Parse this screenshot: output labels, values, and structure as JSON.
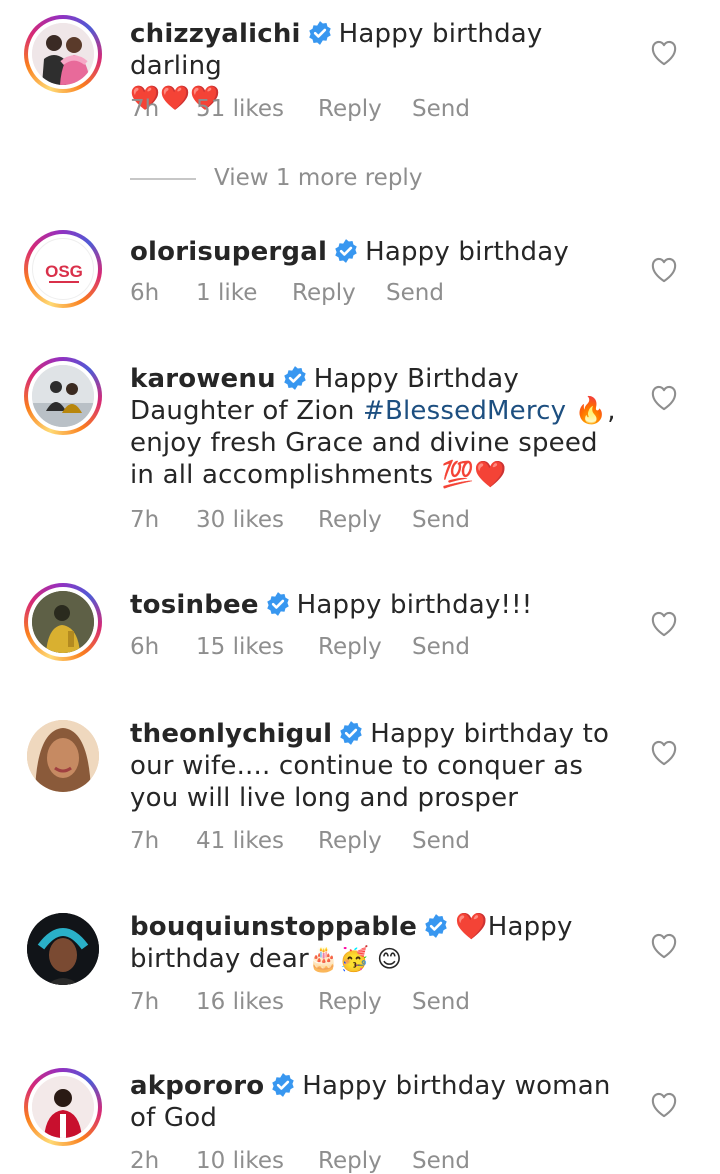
{
  "comments": [
    {
      "username": "chizzyalichi",
      "text": "Happy birthday darling",
      "extra": "❤️❤️❤️",
      "time": "7h",
      "likes": "51 likes",
      "reply": "Reply",
      "send": "Send",
      "ring": "gradient",
      "avatar_colors": [
        "#3a3030",
        "#e86a9a",
        "#f2c0d0"
      ]
    },
    {
      "username": "olorisupergal",
      "text": "Happy birthday",
      "time": "6h",
      "likes": "1 like",
      "reply": "Reply",
      "send": "Send",
      "ring": "gradient",
      "avatar_logo": "OSG"
    },
    {
      "username": "karowenu",
      "text_parts": [
        "Happy Birthday Daughter of Zion ",
        "#BlessedMercy",
        " 🔥, enjoy fresh Grace and divine speed in all accomplishments 💯❤️"
      ],
      "time": "7h",
      "likes": "30 likes",
      "reply": "Reply",
      "send": "Send",
      "ring": "gradient",
      "avatar_colors": [
        "#d9dde0",
        "#2d2d2d",
        "#b8860b"
      ]
    },
    {
      "username": "tosinbee",
      "text": "Happy birthday!!!",
      "time": "6h",
      "likes": "15 likes",
      "reply": "Reply",
      "send": "Send",
      "ring": "gradient",
      "avatar_colors": [
        "#6b6b4a",
        "#2a2a1e",
        "#d9b030"
      ]
    },
    {
      "username": "theonlychigul",
      "text": "Happy birthday to our wife.... continue to conquer as you will live long and prosper",
      "time": "7h",
      "likes": "41 likes",
      "reply": "Reply",
      "send": "Send",
      "ring": "none",
      "avatar_colors": [
        "#e8c9a6",
        "#8a5a3a",
        "#c68a62"
      ]
    },
    {
      "username": "bouquiunstoppable",
      "text_parts": [
        "❤️Happy birthday dear",
        "🎂🥳 😊"
      ],
      "time": "7h",
      "likes": "16 likes",
      "reply": "Reply",
      "send": "Send",
      "ring": "none",
      "avatar_colors": [
        "#111418",
        "#2ab0c8",
        "#7a4a32"
      ]
    },
    {
      "username": "akpororo",
      "text": "Happy birthday woman of God",
      "time": "2h",
      "likes": "10 likes",
      "reply": "Reply",
      "send": "Send",
      "ring": "gradient",
      "avatar_colors": [
        "#c8102e",
        "#f3e9e9",
        "#2a1a14"
      ]
    }
  ],
  "view_more": "View 1 more reply",
  "colors": {
    "meta_gray": "#8e8e8e",
    "verified_blue": "#3897f0",
    "hashtag_blue": "#1d4f80"
  },
  "icons": {
    "like": "heart-outline-icon",
    "verified": "verified-badge-icon"
  }
}
